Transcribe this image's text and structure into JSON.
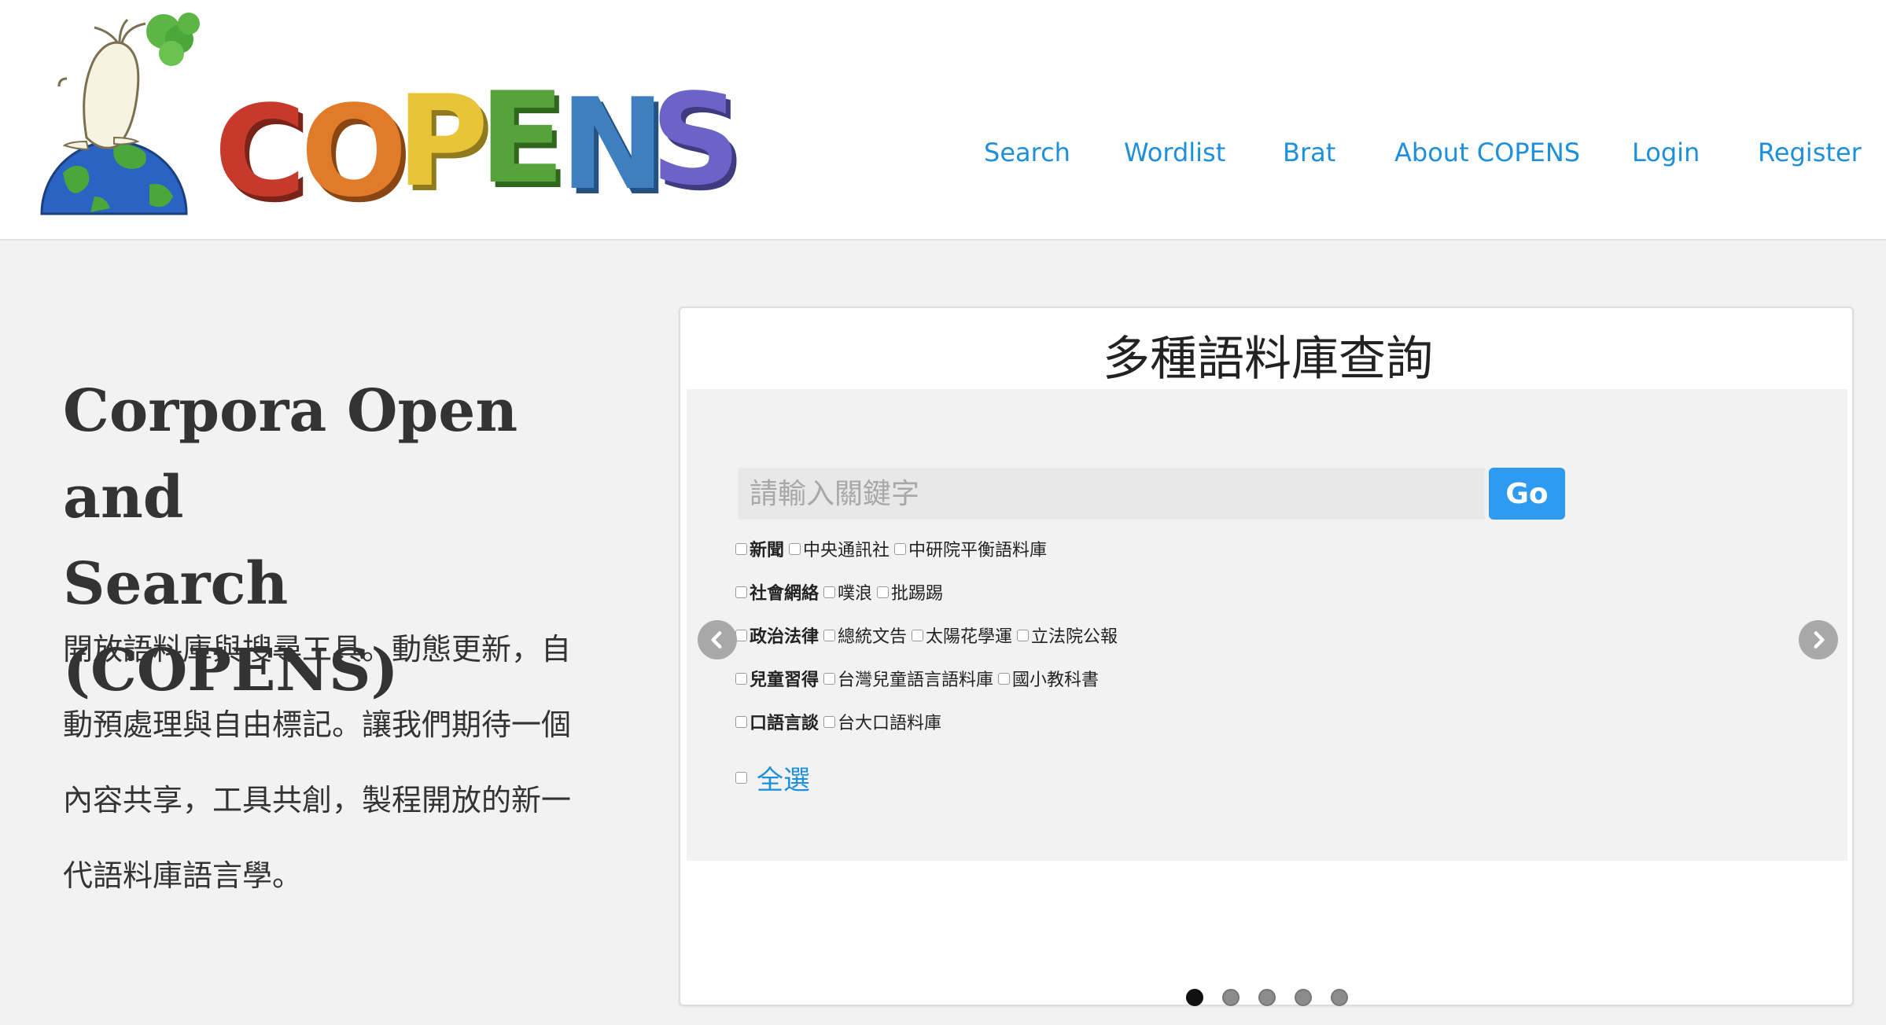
{
  "header": {
    "logo_text": "COPENS",
    "nav": [
      {
        "label": "Search"
      },
      {
        "label": "Wordlist"
      },
      {
        "label": "Brat"
      },
      {
        "label": "About COPENS"
      },
      {
        "label": "Login"
      },
      {
        "label": "Register"
      }
    ]
  },
  "hero": {
    "title_line1": "Corpora Open and",
    "title_line2": "Search (COPENS)",
    "desc_lines": [
      "開放語料庫與搜尋工具。動態更新，自",
      "動預處理與自由標記。讓我們期待一個",
      "內容共享，工具共創，製程開放的新一",
      "代語料庫語言學。"
    ]
  },
  "panel": {
    "title": "多種語料庫查詢",
    "search": {
      "placeholder": "請輸入關鍵字",
      "value": ""
    },
    "go_label": "Go",
    "categories": [
      {
        "label": "新聞",
        "options": [
          "中央通訊社",
          "中研院平衡語料庫"
        ]
      },
      {
        "label": "社會網絡",
        "options": [
          "噗浪",
          "批踢踢"
        ]
      },
      {
        "label": "政治法律",
        "options": [
          "總統文告",
          "太陽花學運",
          "立法院公報"
        ]
      },
      {
        "label": "兒童習得",
        "options": [
          "台灣兒童語言語料庫",
          "國小教科書"
        ]
      },
      {
        "label": "口語言談",
        "options": [
          "台大口語料庫"
        ]
      }
    ],
    "select_all_label": "全選",
    "carousel": {
      "slide_count": 5,
      "active_index": 0
    }
  },
  "colors": {
    "accent": "#1e8fd9",
    "go_button": "#2e9bf0",
    "logo_letters": [
      "#c73a2b",
      "#e07b2a",
      "#e8c437",
      "#56a33b",
      "#3d7fbf",
      "#6b63c8"
    ]
  }
}
